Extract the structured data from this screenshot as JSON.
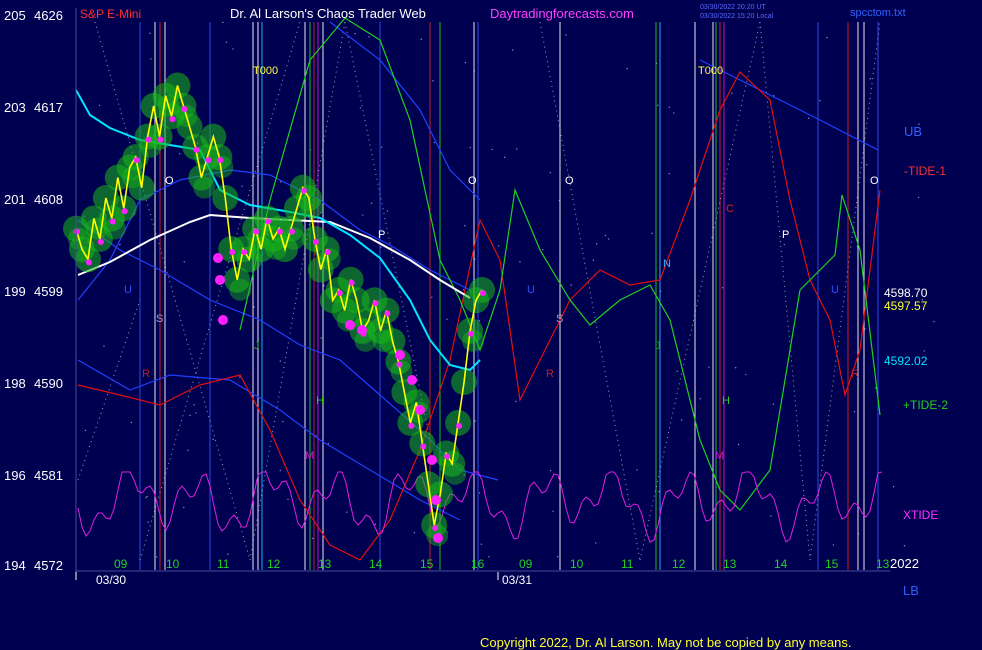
{
  "header": {
    "symbol": "S&P E-Mini",
    "title": "Dr. Al Larson's Chaos Trader Web",
    "site": "Daytradingforecasts.com",
    "timestamp_utc": "03/30/2022 20:20 UT",
    "timestamp_local": "03/30/2022 15:20 Local",
    "data_file": "spcctom.txt"
  },
  "footer": {
    "copyright": "Copyright 2022, Dr. Al Larson. May not be copied by any means.",
    "year": "2022",
    "lb_label": "LB",
    "date_labels": [
      "03/30",
      "03/31"
    ]
  },
  "colors": {
    "background": "#000050",
    "price": "#ffff00",
    "ma_fast": "#00e5ff",
    "ma_slow": "#ffffff",
    "tide1": "#e01010",
    "tide2": "#20d020",
    "xtide": "#e020e0",
    "bands": "#2040ff",
    "glow": "#18b818",
    "dots": "#ff20ff"
  },
  "chart_data": {
    "type": "line",
    "title": "S&P E-Mini",
    "ylim": [
      4572,
      4626
    ],
    "y_ticks": [
      {
        "left": "205",
        "price": "4626"
      },
      {
        "left": "203",
        "price": "4617"
      },
      {
        "left": "201",
        "price": "4608"
      },
      {
        "left": "199",
        "price": "4599"
      },
      {
        "left": "198",
        "price": "4590"
      },
      {
        "left": "196",
        "price": "4581"
      },
      {
        "left": "194",
        "price": "4572"
      }
    ],
    "x_ticks": [
      "09",
      "10",
      "11",
      "12",
      "13",
      "14",
      "15",
      "16",
      "09",
      "10",
      "11",
      "12",
      "13",
      "14",
      "15",
      "13"
    ],
    "t000_label": "T000",
    "right_labels": {
      "ub": "UB",
      "tide1": "-TIDE-1",
      "price1": "4598.70",
      "price2": "4597.57",
      "ma": "4592.02",
      "tide2": "+TIDE-2",
      "xtide": "XTIDE"
    },
    "planet_letters": [
      "O",
      "O",
      "O",
      "O",
      "P",
      "P",
      "S",
      "S",
      "U",
      "U",
      "U",
      "R",
      "R",
      "R",
      "N",
      "J",
      "J",
      "H",
      "H",
      "M",
      "M",
      "C"
    ],
    "series": [
      {
        "name": "S&P E-Mini",
        "values": [
          4605,
          4603,
          4602,
          4606,
          4604,
          4608,
          4606,
          4610,
          4607,
          4611,
          4612,
          4609,
          4614,
          4617,
          4614,
          4618,
          4616,
          4619,
          4617,
          4615,
          4613,
          4610,
          4612,
          4614,
          4612,
          4608,
          4603,
          4600,
          4603,
          4602,
          4605,
          4603,
          4606,
          4604,
          4605,
          4603,
          4605,
          4607,
          4609,
          4608,
          4604,
          4601,
          4603,
          4598,
          4599,
          4597,
          4600,
          4598,
          4595,
          4596,
          4598,
          4595,
          4597,
          4594,
          4592,
          4589,
          4586,
          4588,
          4584,
          4580,
          4576,
          4579,
          4583,
          4582,
          4586,
          4590,
          4595,
          4598,
          4599
        ]
      },
      {
        "name": "-TIDE-1"
      },
      {
        "name": "+TIDE-2"
      },
      {
        "name": "XTIDE"
      }
    ]
  }
}
